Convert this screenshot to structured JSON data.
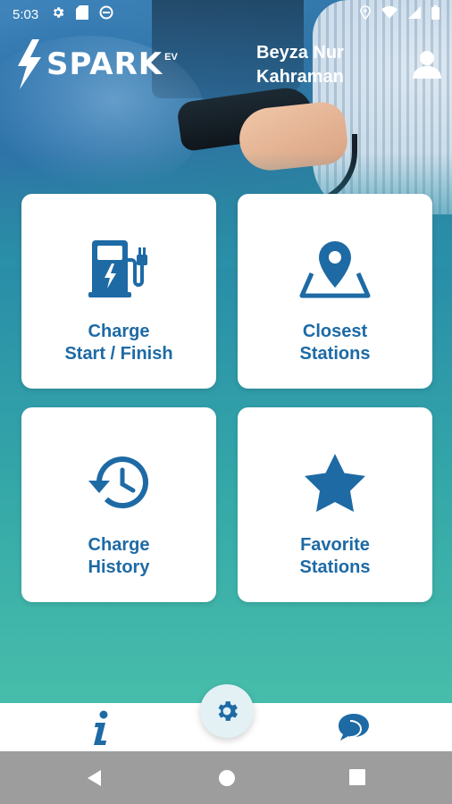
{
  "status_bar": {
    "time": "5:03",
    "left_icons": [
      "settings-icon",
      "sd-card-icon",
      "no-disturb-icon"
    ],
    "right_icons": [
      "location-icon",
      "wifi-icon",
      "signal-icon",
      "battery-icon"
    ]
  },
  "header": {
    "logo_text": "SPARK",
    "logo_superscript": "EV",
    "user_name": "Beyza Nur\nKahraman",
    "user_icon": "user-icon"
  },
  "tiles": [
    {
      "label": "Charge\nStart / Finish",
      "icon": "charging-station-icon"
    },
    {
      "label": "Closest\nStations",
      "icon": "map-pin-icon"
    },
    {
      "label": "Charge\nHistory",
      "icon": "history-icon"
    },
    {
      "label": "Favorite\nStations",
      "icon": "star-icon"
    }
  ],
  "bottom_bar": {
    "left_icon": "info-icon",
    "center_icon": "gear-icon",
    "right_icon": "chat-icon"
  },
  "nav_bar": {
    "icons": [
      "back-icon",
      "home-icon",
      "recents-icon"
    ]
  },
  "colors": {
    "accent": "#1d6aa5",
    "gradient_top": "#2b6f9e",
    "gradient_bottom": "#46bcaa",
    "tile_background": "#ffffff",
    "nav_bar": "#9d9d9d"
  }
}
